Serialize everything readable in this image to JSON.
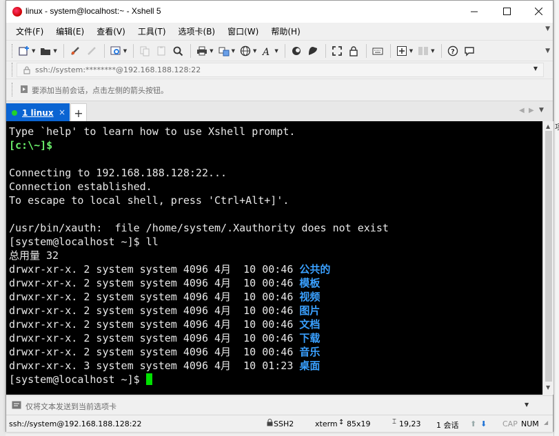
{
  "window": {
    "title": "linux - system@localhost:~ - Xshell 5"
  },
  "menu": [
    "文件(F)",
    "编辑(E)",
    "查看(V)",
    "工具(T)",
    "选项卡(B)",
    "窗口(W)",
    "帮助(H)"
  ],
  "address": {
    "text": "ssh://system:********@192.168.188.128:22"
  },
  "tip": {
    "text": "要添加当前会话，点击左侧的箭头按钮。"
  },
  "tabs": {
    "active_label": "1 linux",
    "add_label": "+",
    "close_label": "×"
  },
  "terminal": {
    "lines": [
      {
        "t": "Type `help' to learn how to use Xshell prompt."
      },
      {
        "t": "[c:\\~]$",
        "style": "green"
      },
      {
        "t": ""
      },
      {
        "t": "Connecting to 192.168.188.128:22..."
      },
      {
        "t": "Connection established."
      },
      {
        "t": "To escape to local shell, press 'Ctrl+Alt+]'."
      },
      {
        "t": ""
      },
      {
        "t": "/usr/bin/xauth:  file /home/system/.Xauthority does not exist"
      },
      {
        "t": "[system@localhost ~]$ ll"
      },
      {
        "t": "总用量 32"
      },
      {
        "t": "drwxr-xr-x. 2 system system 4096 4月  10 00:46 ",
        "dir": "公共的"
      },
      {
        "t": "drwxr-xr-x. 2 system system 4096 4月  10 00:46 ",
        "dir": "模板"
      },
      {
        "t": "drwxr-xr-x. 2 system system 4096 4月  10 00:46 ",
        "dir": "视频"
      },
      {
        "t": "drwxr-xr-x. 2 system system 4096 4月  10 00:46 ",
        "dir": "图片"
      },
      {
        "t": "drwxr-xr-x. 2 system system 4096 4月  10 00:46 ",
        "dir": "文档"
      },
      {
        "t": "drwxr-xr-x. 2 system system 4096 4月  10 00:46 ",
        "dir": "下载"
      },
      {
        "t": "drwxr-xr-x. 2 system system 4096 4月  10 00:46 ",
        "dir": "音乐"
      },
      {
        "t": "drwxr-xr-x. 3 system system 4096 4月  10 01:23 ",
        "dir": "桌面"
      },
      {
        "t": "[system@localhost ~]$ ",
        "cursor": true
      }
    ]
  },
  "compose": {
    "placeholder": "仅将文本发送到当前选项卡"
  },
  "status": {
    "connection": "ssh://system@192.168.188.128:22",
    "protocol": "SSH2",
    "terminal_type": "xterm",
    "size": "85x19",
    "cursor_pos": "19,23",
    "sessions": "1 会话",
    "cap": "CAP",
    "num": "NUM"
  },
  "background": {
    "right_text_1": "项"
  },
  "colors": {
    "tab_active": "#0a64d2",
    "terminal_bg": "#000000",
    "prompt_green": "#6bf16b",
    "dir_blue": "#3aa0ff",
    "cursor": "#00e000"
  }
}
